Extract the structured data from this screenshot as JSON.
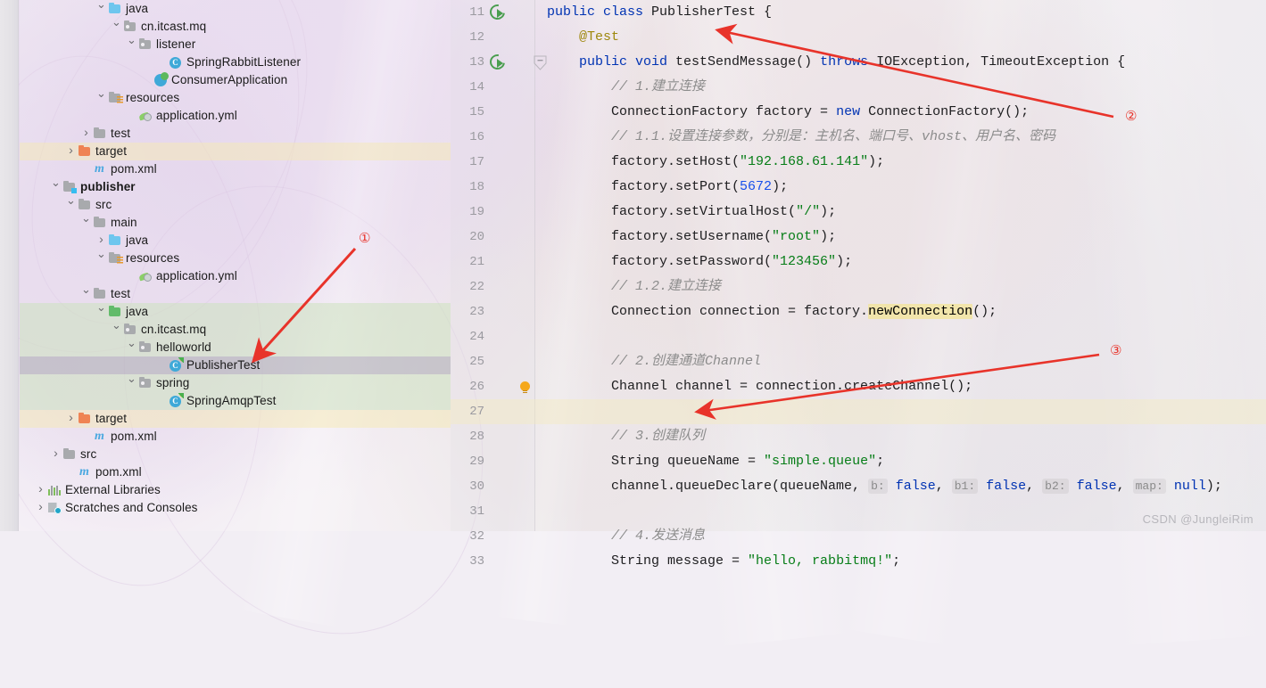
{
  "sidebar": {
    "items": [
      {
        "indent": 5,
        "arrow": "down",
        "icon": "folder-blue",
        "label": "java",
        "state": "none"
      },
      {
        "indent": 6,
        "arrow": "down",
        "icon": "folder-pkg",
        "label": "cn.itcast.mq",
        "state": "none"
      },
      {
        "indent": 7,
        "arrow": "down",
        "icon": "folder-pkg",
        "label": "listener",
        "state": "none"
      },
      {
        "indent": 9,
        "arrow": "none",
        "icon": "class",
        "label": "SpringRabbitListener",
        "state": "none"
      },
      {
        "indent": 8,
        "arrow": "none",
        "icon": "spring-class",
        "label": "ConsumerApplication",
        "state": "none"
      },
      {
        "indent": 5,
        "arrow": "down",
        "icon": "folder-res",
        "label": "resources",
        "state": "none"
      },
      {
        "indent": 7,
        "arrow": "none",
        "icon": "yml",
        "label": "application.yml",
        "state": "none"
      },
      {
        "indent": 4,
        "arrow": "right",
        "icon": "folder-grey",
        "label": "test",
        "state": "none"
      },
      {
        "indent": 3,
        "arrow": "right",
        "icon": "folder-orange",
        "label": "target",
        "state": "yellow"
      },
      {
        "indent": 4,
        "arrow": "none",
        "icon": "maven",
        "label": "pom.xml",
        "state": "none"
      },
      {
        "indent": 2,
        "arrow": "down",
        "icon": "folder-module",
        "label": "publisher",
        "state": "none",
        "bold": true
      },
      {
        "indent": 3,
        "arrow": "down",
        "icon": "folder-grey",
        "label": "src",
        "state": "none"
      },
      {
        "indent": 4,
        "arrow": "down",
        "icon": "folder-grey",
        "label": "main",
        "state": "none"
      },
      {
        "indent": 5,
        "arrow": "right",
        "icon": "folder-blue",
        "label": "java",
        "state": "none"
      },
      {
        "indent": 5,
        "arrow": "down",
        "icon": "folder-res",
        "label": "resources",
        "state": "none"
      },
      {
        "indent": 7,
        "arrow": "none",
        "icon": "yml",
        "label": "application.yml",
        "state": "none"
      },
      {
        "indent": 4,
        "arrow": "down",
        "icon": "folder-grey",
        "label": "test",
        "state": "none"
      },
      {
        "indent": 5,
        "arrow": "down",
        "icon": "folder-srcgreen",
        "label": "java",
        "state": "green"
      },
      {
        "indent": 6,
        "arrow": "down",
        "icon": "folder-pkg",
        "label": "cn.itcast.mq",
        "state": "green"
      },
      {
        "indent": 7,
        "arrow": "down",
        "icon": "folder-pkg",
        "label": "helloworld",
        "state": "green"
      },
      {
        "indent": 9,
        "arrow": "none",
        "icon": "test-class",
        "label": "PublisherTest",
        "state": "grey"
      },
      {
        "indent": 7,
        "arrow": "down",
        "icon": "folder-pkg",
        "label": "spring",
        "state": "green"
      },
      {
        "indent": 9,
        "arrow": "none",
        "icon": "test-class",
        "label": "SpringAmqpTest",
        "state": "green"
      },
      {
        "indent": 3,
        "arrow": "right",
        "icon": "folder-orange",
        "label": "target",
        "state": "yellow"
      },
      {
        "indent": 4,
        "arrow": "none",
        "icon": "maven",
        "label": "pom.xml",
        "state": "none"
      },
      {
        "indent": 2,
        "arrow": "right",
        "icon": "folder-grey",
        "label": "src",
        "state": "none"
      },
      {
        "indent": 3,
        "arrow": "none",
        "icon": "maven",
        "label": "pom.xml",
        "state": "none"
      },
      {
        "indent": 1,
        "arrow": "right",
        "icon": "ext-lib",
        "label": "External Libraries",
        "state": "none"
      },
      {
        "indent": 1,
        "arrow": "right",
        "icon": "scratch",
        "label": "Scratches and Consoles",
        "state": "none"
      }
    ]
  },
  "editor": {
    "lines": [
      {
        "num": "11",
        "gutter": "run",
        "fold": false,
        "highlight": false,
        "tokens": [
          {
            "t": "public ",
            "c": "kw"
          },
          {
            "t": "class ",
            "c": "kw"
          },
          {
            "t": "PublisherTest {",
            "c": "plain"
          }
        ],
        "indent": 0
      },
      {
        "num": "12",
        "gutter": "",
        "fold": false,
        "highlight": false,
        "tokens": [
          {
            "t": "@Test",
            "c": "ann"
          }
        ],
        "indent": 1
      },
      {
        "num": "13",
        "gutter": "run",
        "fold": true,
        "highlight": false,
        "tokens": [
          {
            "t": "public ",
            "c": "kw"
          },
          {
            "t": "void ",
            "c": "kw"
          },
          {
            "t": "testSendMessage() ",
            "c": "plain"
          },
          {
            "t": "throws ",
            "c": "kw"
          },
          {
            "t": "IOException, TimeoutException {",
            "c": "plain"
          }
        ],
        "indent": 1
      },
      {
        "num": "14",
        "gutter": "",
        "fold": false,
        "highlight": false,
        "tokens": [
          {
            "t": "// 1.建立连接",
            "c": "cmt"
          }
        ],
        "indent": 2
      },
      {
        "num": "15",
        "gutter": "",
        "fold": false,
        "highlight": false,
        "tokens": [
          {
            "t": "ConnectionFactory factory = ",
            "c": "plain"
          },
          {
            "t": "new ",
            "c": "kw"
          },
          {
            "t": "ConnectionFactory();",
            "c": "plain"
          }
        ],
        "indent": 2
      },
      {
        "num": "16",
        "gutter": "",
        "fold": false,
        "highlight": false,
        "tokens": [
          {
            "t": "// 1.1.设置连接参数，分别是：主机名、端口号、vhost、用户名、密码",
            "c": "cmt"
          }
        ],
        "indent": 2
      },
      {
        "num": "17",
        "gutter": "",
        "fold": false,
        "highlight": false,
        "tokens": [
          {
            "t": "factory.setHost(",
            "c": "plain"
          },
          {
            "t": "\"192.168.61.141\"",
            "c": "str"
          },
          {
            "t": ");",
            "c": "plain"
          }
        ],
        "indent": 2
      },
      {
        "num": "18",
        "gutter": "",
        "fold": false,
        "highlight": false,
        "tokens": [
          {
            "t": "factory.setPort(",
            "c": "plain"
          },
          {
            "t": "5672",
            "c": "num"
          },
          {
            "t": ");",
            "c": "plain"
          }
        ],
        "indent": 2
      },
      {
        "num": "19",
        "gutter": "",
        "fold": false,
        "highlight": false,
        "tokens": [
          {
            "t": "factory.setVirtualHost(",
            "c": "plain"
          },
          {
            "t": "\"/\"",
            "c": "str"
          },
          {
            "t": ");",
            "c": "plain"
          }
        ],
        "indent": 2
      },
      {
        "num": "20",
        "gutter": "",
        "fold": false,
        "highlight": false,
        "tokens": [
          {
            "t": "factory.setUsername(",
            "c": "plain"
          },
          {
            "t": "\"root\"",
            "c": "str"
          },
          {
            "t": ");",
            "c": "plain"
          }
        ],
        "indent": 2
      },
      {
        "num": "21",
        "gutter": "",
        "fold": false,
        "highlight": false,
        "tokens": [
          {
            "t": "factory.setPassword(",
            "c": "plain"
          },
          {
            "t": "\"123456\"",
            "c": "str"
          },
          {
            "t": ");",
            "c": "plain"
          }
        ],
        "indent": 2
      },
      {
        "num": "22",
        "gutter": "",
        "fold": false,
        "highlight": false,
        "tokens": [
          {
            "t": "// 1.2.建立连接",
            "c": "cmt"
          }
        ],
        "indent": 2
      },
      {
        "num": "23",
        "gutter": "",
        "fold": false,
        "highlight": false,
        "tokens": [
          {
            "t": "Connection connection = factory.",
            "c": "plain"
          },
          {
            "t": "newConnection",
            "c": "mark"
          },
          {
            "t": "();",
            "c": "plain"
          }
        ],
        "indent": 2
      },
      {
        "num": "24",
        "gutter": "",
        "fold": false,
        "highlight": false,
        "tokens": [],
        "indent": 0
      },
      {
        "num": "25",
        "gutter": "",
        "fold": false,
        "highlight": false,
        "tokens": [
          {
            "t": "// 2.创建通道Channel",
            "c": "cmt"
          }
        ],
        "indent": 2
      },
      {
        "num": "26",
        "gutter": "bulb",
        "fold": false,
        "highlight": false,
        "tokens": [
          {
            "t": "Channel channel = connection.createChannel();",
            "c": "plain"
          }
        ],
        "indent": 2
      },
      {
        "num": "27",
        "gutter": "",
        "fold": false,
        "highlight": true,
        "tokens": [],
        "indent": 0
      },
      {
        "num": "28",
        "gutter": "",
        "fold": false,
        "highlight": false,
        "tokens": [
          {
            "t": "// 3.创建队列",
            "c": "cmt"
          }
        ],
        "indent": 2
      },
      {
        "num": "29",
        "gutter": "",
        "fold": false,
        "highlight": false,
        "tokens": [
          {
            "t": "String queueName = ",
            "c": "plain"
          },
          {
            "t": "\"simple.queue\"",
            "c": "str"
          },
          {
            "t": ";",
            "c": "plain"
          }
        ],
        "indent": 2
      },
      {
        "num": "30",
        "gutter": "",
        "fold": false,
        "highlight": false,
        "tokens": [
          {
            "t": "channel.queueDeclare(queueName, ",
            "c": "plain"
          },
          {
            "t": "b:",
            "c": "hint"
          },
          {
            "t": " ",
            "c": "plain"
          },
          {
            "t": "false",
            "c": "kw"
          },
          {
            "t": ", ",
            "c": "plain"
          },
          {
            "t": "b1:",
            "c": "hint"
          },
          {
            "t": " ",
            "c": "plain"
          },
          {
            "t": "false",
            "c": "kw"
          },
          {
            "t": ", ",
            "c": "plain"
          },
          {
            "t": "b2:",
            "c": "hint"
          },
          {
            "t": " ",
            "c": "plain"
          },
          {
            "t": "false",
            "c": "kw"
          },
          {
            "t": ", ",
            "c": "plain"
          },
          {
            "t": "map:",
            "c": "hint"
          },
          {
            "t": " ",
            "c": "plain"
          },
          {
            "t": "null",
            "c": "kw"
          },
          {
            "t": ");",
            "c": "plain"
          }
        ],
        "indent": 2
      },
      {
        "num": "31",
        "gutter": "",
        "fold": false,
        "highlight": false,
        "tokens": [],
        "indent": 0
      },
      {
        "num": "32",
        "gutter": "",
        "fold": false,
        "highlight": false,
        "tokens": [
          {
            "t": "// 4.发送消息",
            "c": "cmt"
          }
        ],
        "indent": 2
      },
      {
        "num": "33",
        "gutter": "",
        "fold": false,
        "highlight": false,
        "tokens": [
          {
            "t": "String message = ",
            "c": "plain"
          },
          {
            "t": "\"hello, rabbitmq!\"",
            "c": "str"
          },
          {
            "t": ";",
            "c": "plain"
          }
        ],
        "indent": 2
      }
    ]
  },
  "annotations": {
    "marker1": "①",
    "marker2": "②",
    "marker3": "③",
    "accent_color": "#e8332a"
  },
  "watermark": {
    "text": "CSDN @JungleiRim"
  }
}
